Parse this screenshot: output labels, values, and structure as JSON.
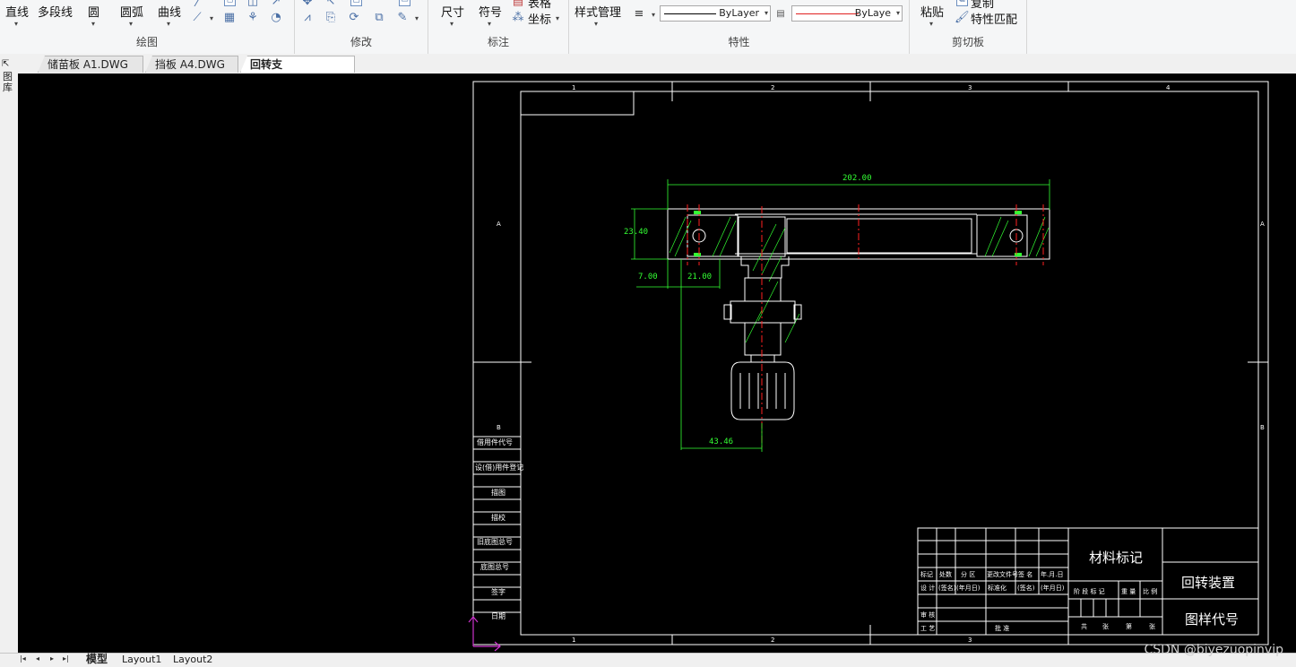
{
  "ribbon": {
    "draw": {
      "label": "绘图",
      "line": "直线",
      "polyline": "多段线",
      "circle": "圆",
      "arc": "圆弧",
      "curve": "曲线"
    },
    "modify": {
      "label": "修改"
    },
    "annotate": {
      "label": "标注",
      "dimension": "尺寸",
      "symbol": "符号",
      "table": "表格",
      "coordinate": "坐标"
    },
    "properties": {
      "label": "特性",
      "style_manager": "样式管理",
      "linetype": "ByLayer",
      "lineweight": "ByLaye",
      "linetype_color": "#000000",
      "lineweight_color": "#e02020"
    },
    "clipboard": {
      "label": "剪切板",
      "paste": "粘贴",
      "copy": "复制",
      "match_properties": "特性匹配"
    }
  },
  "tabs": [
    {
      "label": "储苗板 A1.DWG",
      "active": false
    },
    {
      "label": "挡板 A4.DWG",
      "active": false
    },
    {
      "label": "回转支撑.DWG",
      "active": true
    }
  ],
  "left_strip": {
    "label": "图库"
  },
  "drawing": {
    "zones_top": [
      "1",
      "2",
      "3",
      "4"
    ],
    "zones_side": [
      "A",
      "B"
    ],
    "dimensions": {
      "overall_width": "202.00",
      "height": "23.40",
      "offset_a": "7.00",
      "offset_b": "21.00",
      "motor_offset": "43.46"
    },
    "side_table": [
      "借用件代号",
      "设(借)用件登记",
      "描图",
      "描校",
      "旧底图总号",
      "底图总号",
      "签字",
      "日期"
    ],
    "title_block": {
      "material": "材料标记",
      "name": "回转装置",
      "drawing_no": "图样代号",
      "rev_headers": [
        "标记",
        "处数",
        "分 区",
        "更改文件号",
        "签 名",
        "年.月.日"
      ],
      "rev_sub": [
        "(签名)",
        "(年月日)",
        "标准化",
        "(签名)",
        "(年月日)"
      ],
      "roles": [
        "设 计",
        "审 核",
        "工 艺",
        "批 准"
      ],
      "stage_headers": [
        "阶 段 标 记",
        "重 量",
        "比 例"
      ],
      "sheet_labels": [
        "共",
        "张",
        "第",
        "张"
      ]
    },
    "colors": {
      "frame": "#ffffff",
      "dimension": "#33ff33",
      "centerline": "#ff2020",
      "ucs": "#cc33cc"
    }
  },
  "layout_tabs": [
    {
      "label": "模型",
      "active": true
    },
    {
      "label": "Layout1",
      "active": false
    },
    {
      "label": "Layout2",
      "active": false
    }
  ],
  "watermark": "CSDN @biyezuopinvip"
}
